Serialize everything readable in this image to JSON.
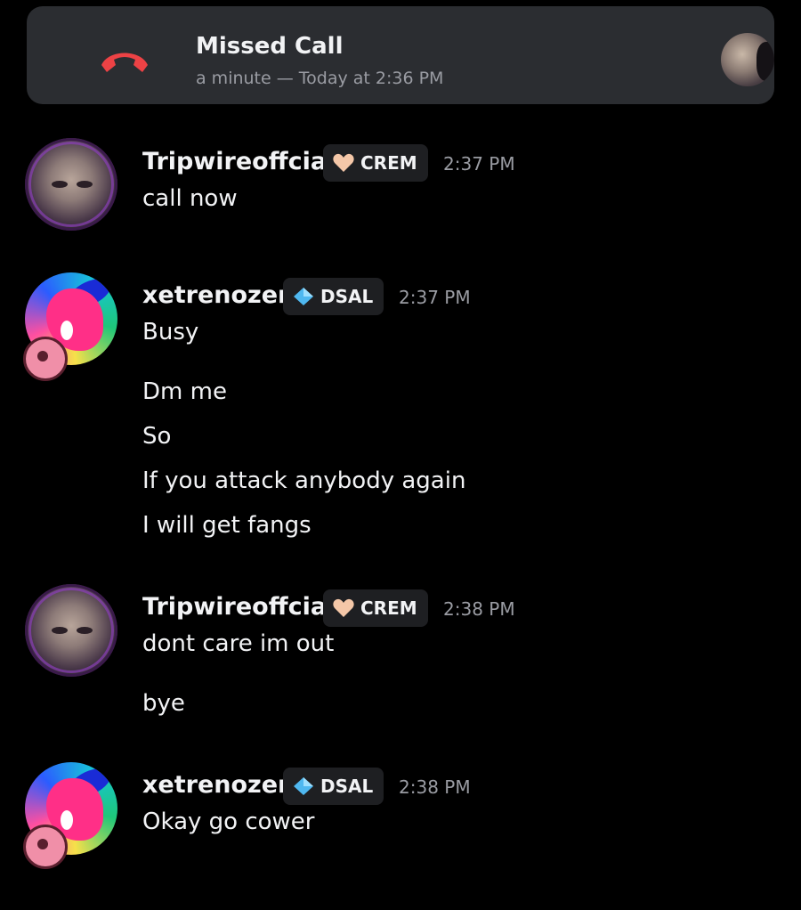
{
  "missed_call": {
    "title": "Missed Call",
    "subtitle": "a minute — Today at 2:36 PM",
    "icon": "phone-hangup-icon"
  },
  "messages": [
    {
      "author": "Tripwireoffcial",
      "tag": "CREM",
      "tag_icon": "heart-icon",
      "time": "2:37 PM",
      "lines": [
        "call now"
      ]
    },
    {
      "author": "xetrenozen",
      "tag": "DSAL",
      "tag_icon": "diamond-icon",
      "time": "2:37 PM",
      "lines": [
        "Busy",
        "Dm me",
        "So",
        "If you attack anybody again",
        "I will get fangs"
      ]
    },
    {
      "author": "Tripwireoffcial",
      "tag": "CREM",
      "tag_icon": "heart-icon",
      "time": "2:38 PM",
      "lines": [
        "dont care im out",
        "bye"
      ]
    },
    {
      "author": "xetrenozen",
      "tag": "DSAL",
      "tag_icon": "diamond-icon",
      "time": "2:38 PM",
      "lines": [
        "Okay go cower"
      ]
    }
  ],
  "colors": {
    "background": "#000000",
    "card": "#2b2d31",
    "hangup_red": "#ed4245",
    "muted_text": "#9a9ca3",
    "tag_bg": "#1e1f22"
  }
}
